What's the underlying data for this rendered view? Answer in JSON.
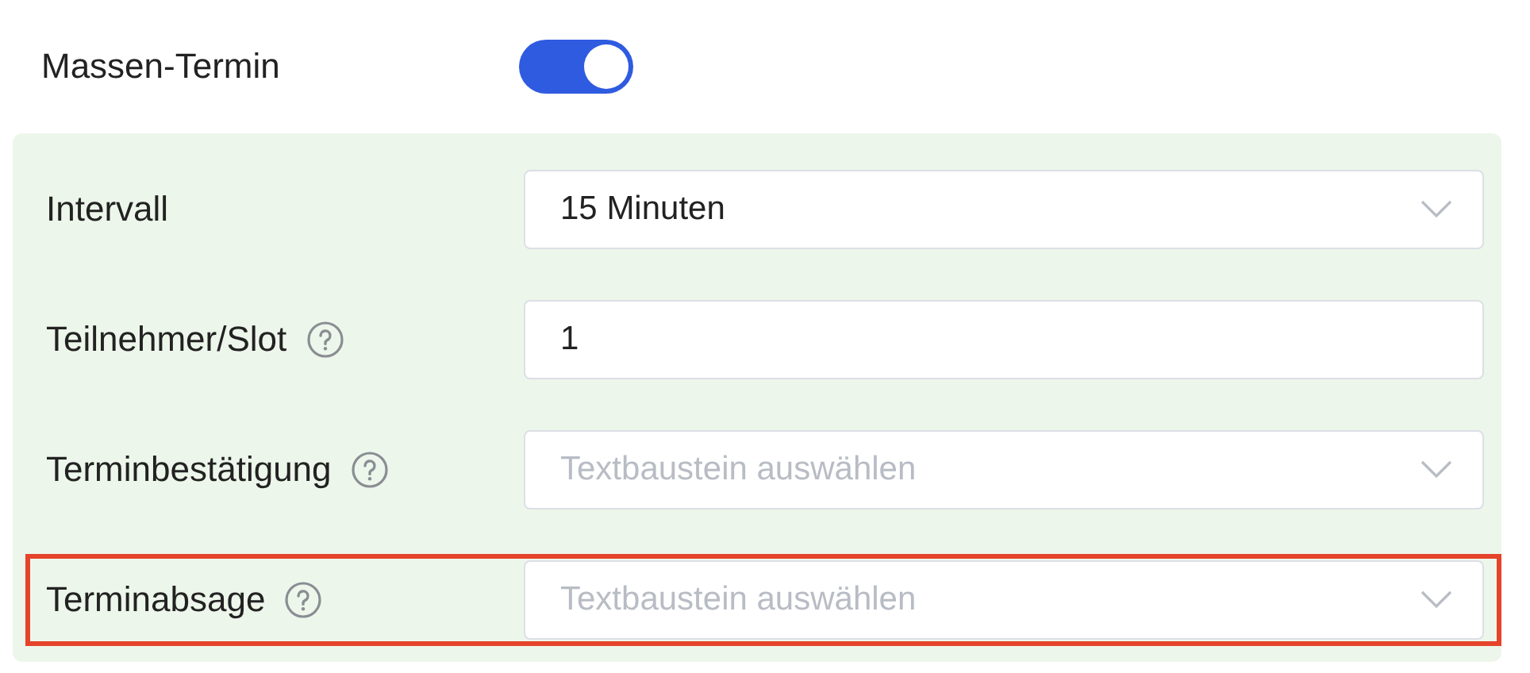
{
  "toggle_row": {
    "label": "Massen-Termin",
    "on": true
  },
  "fields": [
    {
      "label": "Intervall",
      "help": false,
      "kind": "select",
      "value": "15 Minuten",
      "highlighted": false
    },
    {
      "label": "Teilnehmer/Slot",
      "help": true,
      "kind": "text",
      "value": "1",
      "highlighted": false
    },
    {
      "label": "Terminbestätigung",
      "help": true,
      "kind": "select",
      "placeholder": "Textbaustein auswählen",
      "highlighted": false
    },
    {
      "label": "Terminabsage",
      "help": true,
      "kind": "select",
      "placeholder": "Textbaustein auswählen",
      "highlighted": true
    }
  ]
}
